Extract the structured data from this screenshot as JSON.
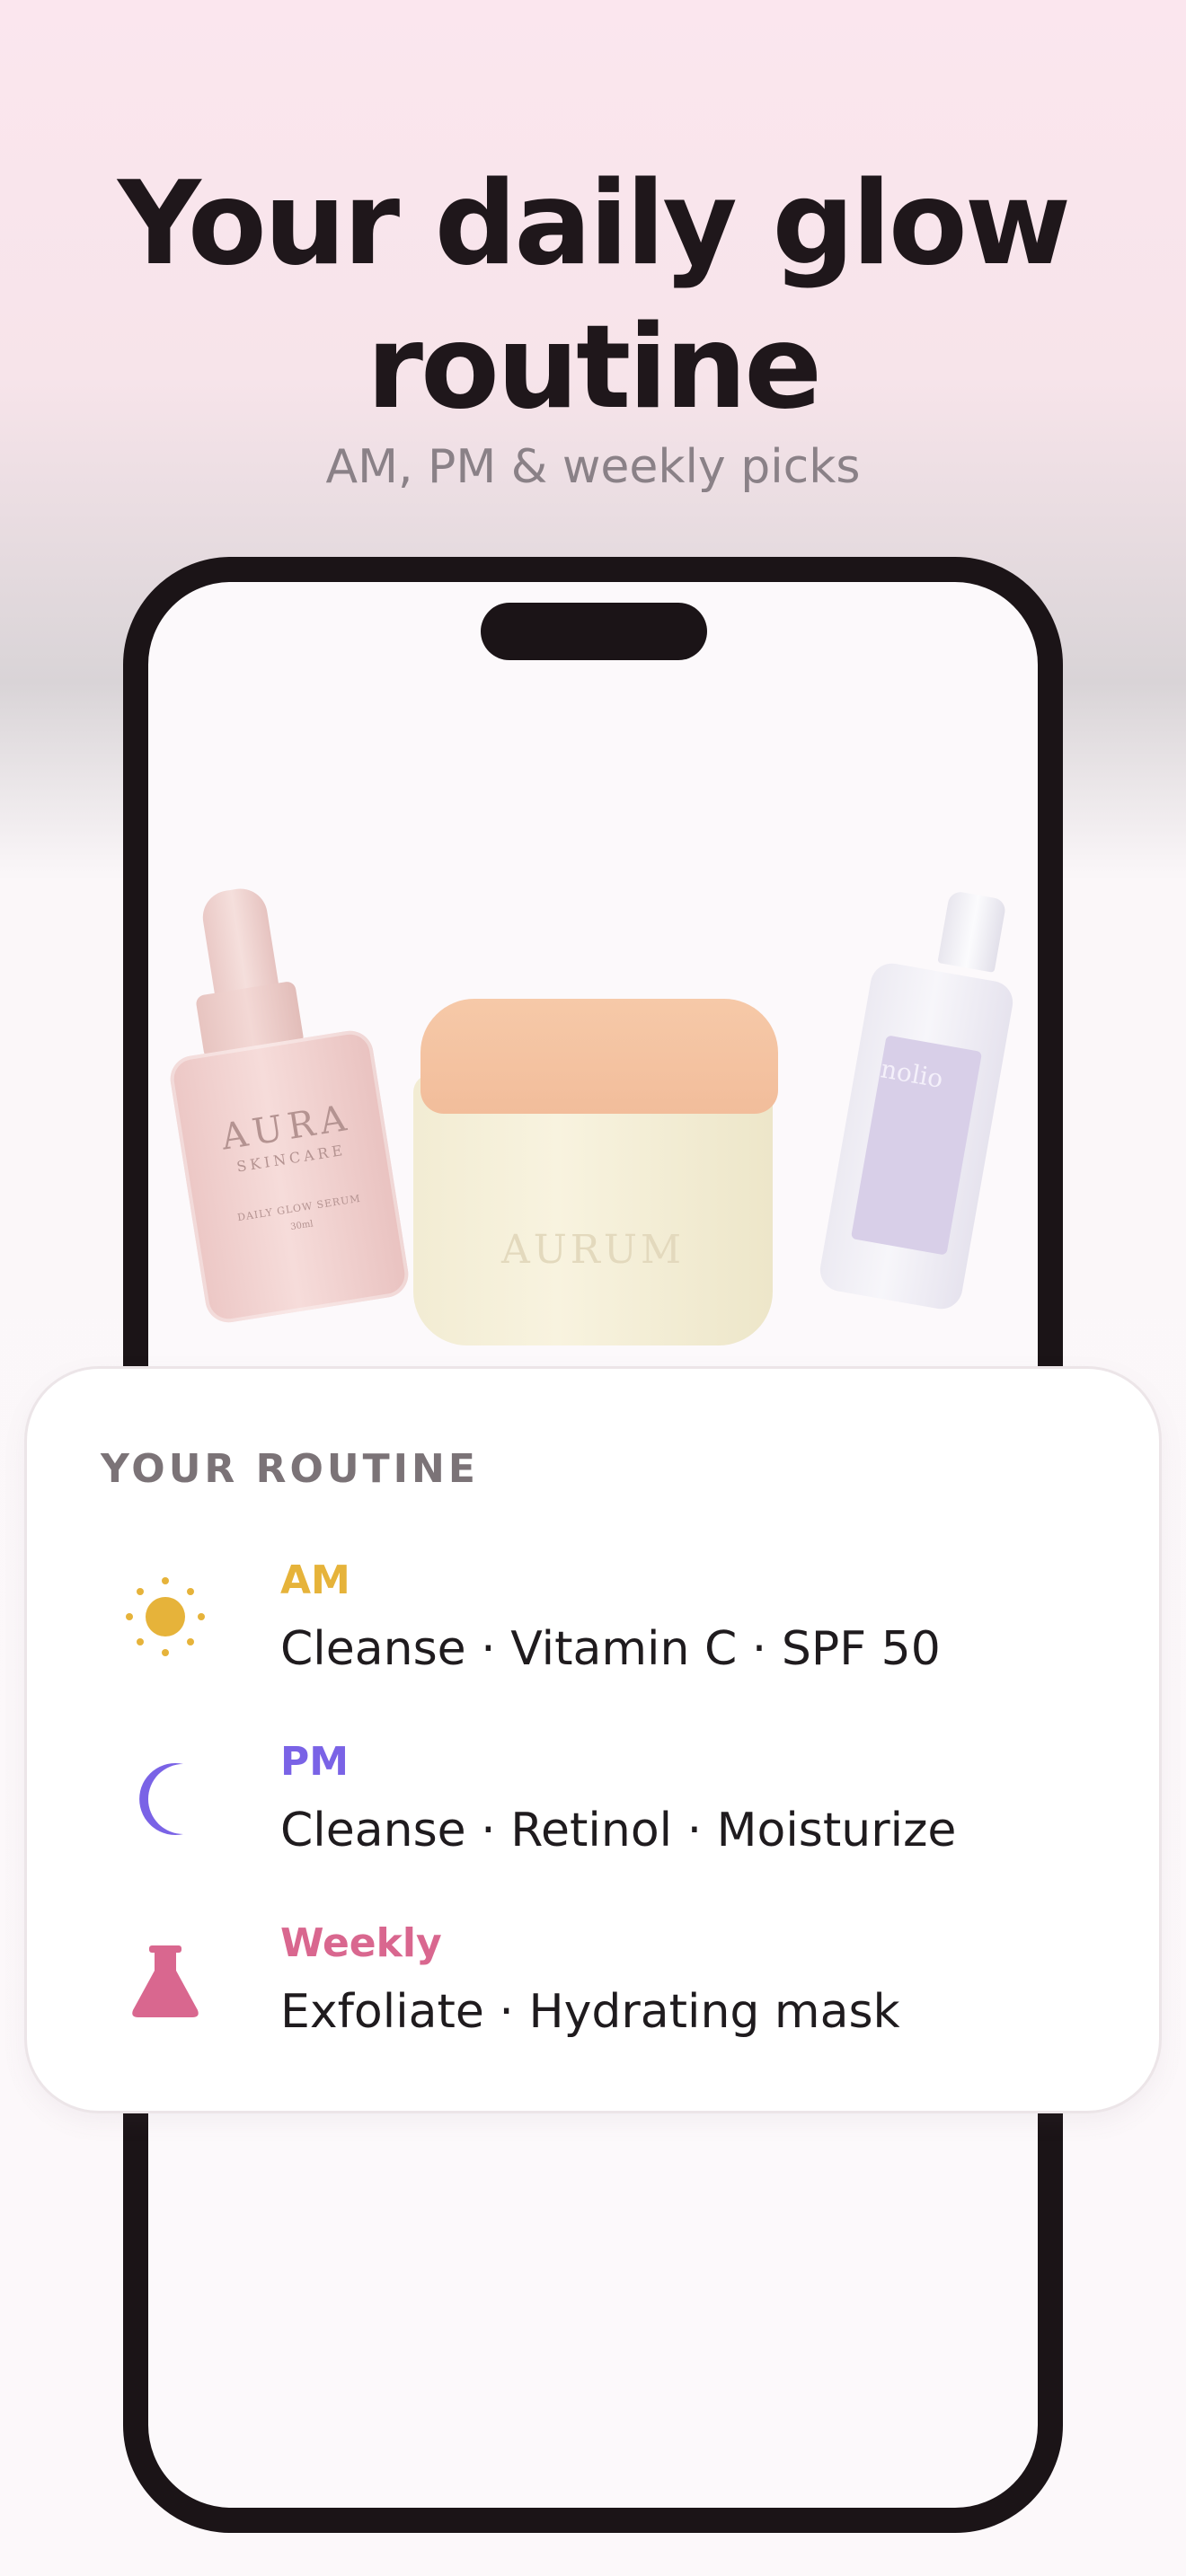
{
  "header": {
    "title_line1": "Your daily glow",
    "title_line2": "routine",
    "subtitle": "AM, PM & weekly picks"
  },
  "products": {
    "serum": {
      "brand": "AURA",
      "sub": "SKINCARE",
      "name": "DAILY GLOW SERUM",
      "size": "30ml"
    },
    "jar": {
      "brand": "AURUM"
    },
    "pump": {
      "brand": "nolio"
    }
  },
  "routine": {
    "title": "YOUR ROUTINE",
    "items": [
      {
        "label": "AM",
        "text": "Cleanse · Vitamin C · SPF 50",
        "icon": "sun-icon",
        "color": "#e6b33a"
      },
      {
        "label": "PM",
        "text": "Cleanse · Retinol · Moisturize",
        "icon": "moon-icon",
        "color": "#7a63e6"
      },
      {
        "label": "Weekly",
        "text": "Exfoliate · Hydrating mask",
        "icon": "flask-icon",
        "color": "#d9678f"
      }
    ]
  },
  "colors": {
    "am": "#e6b33a",
    "pm": "#7a63e6",
    "weekly": "#d9678f",
    "ink": "#1f171b"
  }
}
